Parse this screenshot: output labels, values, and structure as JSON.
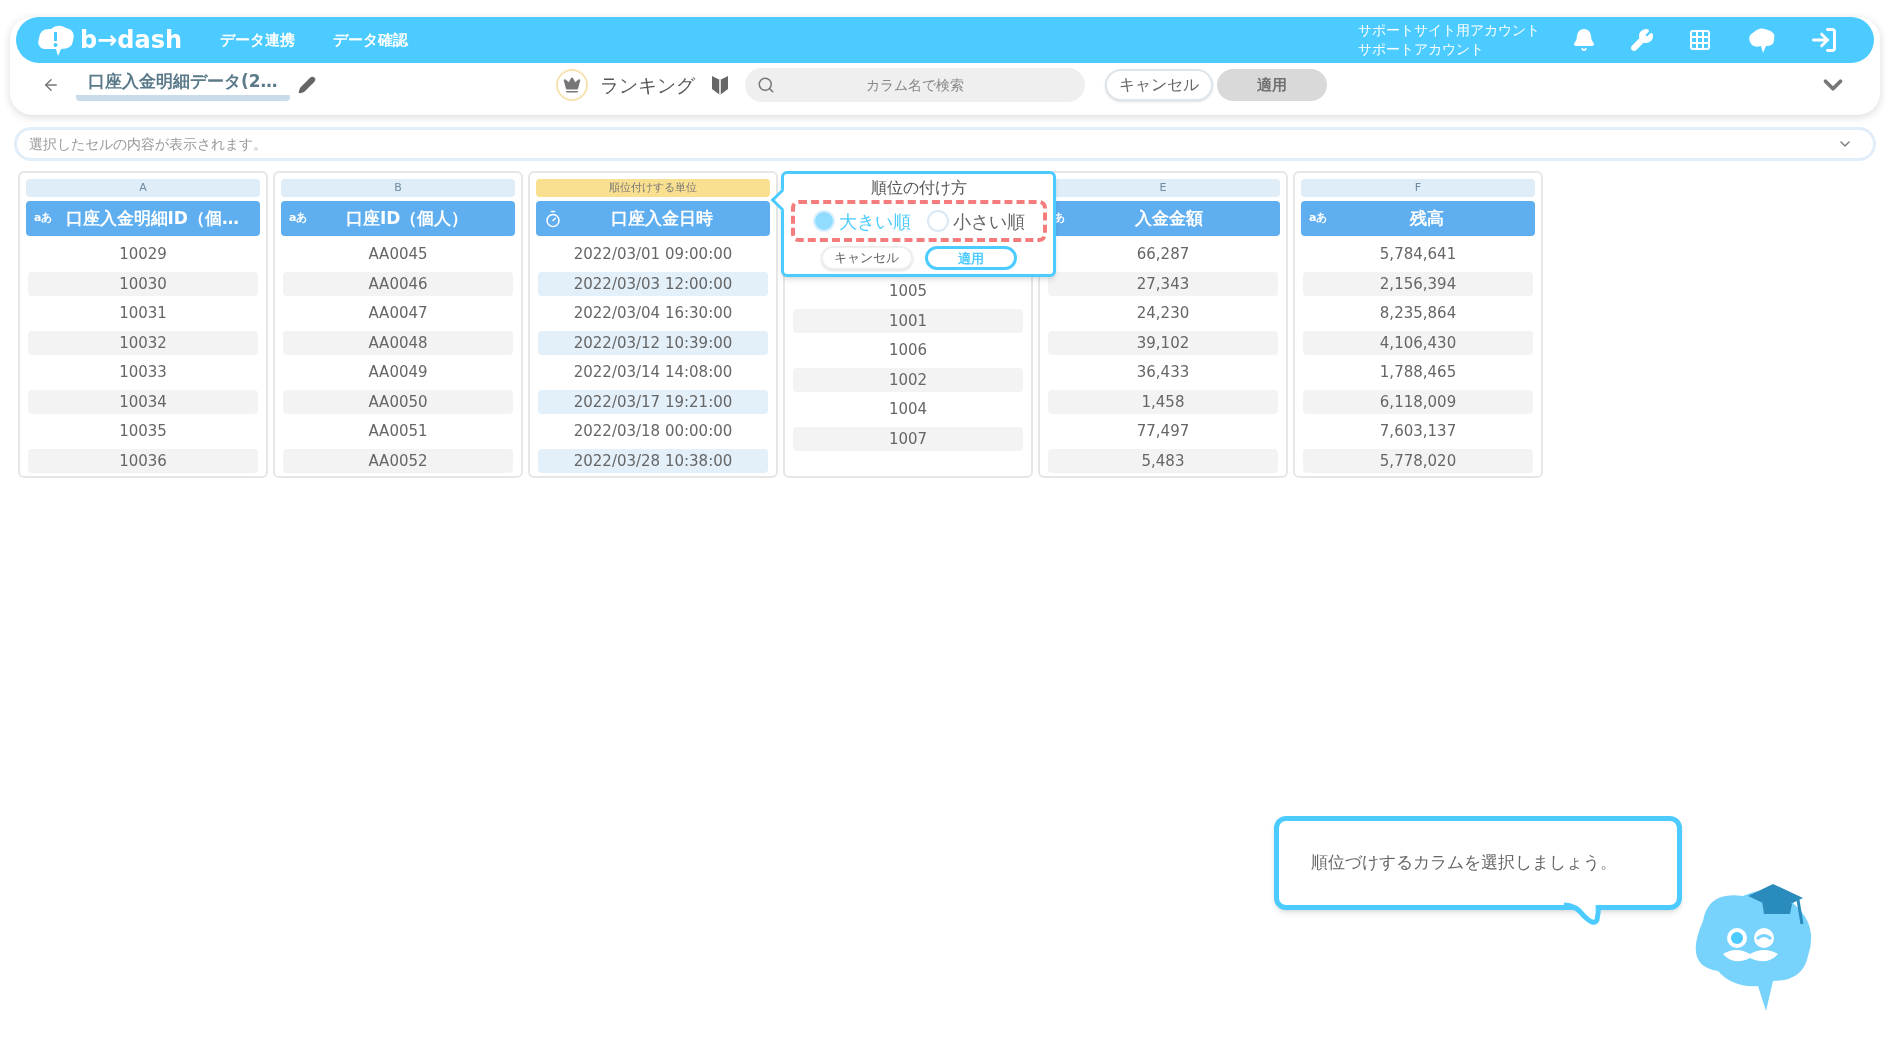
{
  "top_bar": {
    "logo": "b→dash",
    "nav": [
      "データ連携",
      "データ確認"
    ],
    "account": [
      "サポートサイト用アカウント",
      "サポートアカウント"
    ]
  },
  "toolbar": {
    "title": "口座入金明細データ(2…",
    "mode": "ランキング",
    "search": {
      "placeholder": "カラム名で検索"
    },
    "cancel": "キャンセル",
    "apply": {
      "label": "適用",
      "disabled": true
    }
  },
  "cell_bar": {
    "placeholder": "選択したセルの内容が表示されます。"
  },
  "columns": [
    {
      "letter": "A",
      "header": "口座入金明細ID（個…",
      "kind": "text",
      "type_label": "aあ",
      "selected": false,
      "rows": [
        "10029",
        "10030",
        "10031",
        "10032",
        "10033",
        "10034",
        "10035",
        "10036"
      ]
    },
    {
      "letter": "B",
      "header": "口座ID（個人）",
      "kind": "text",
      "type_label": "aあ",
      "selected": false,
      "rows": [
        "AA0045",
        "AA0046",
        "AA0047",
        "AA0048",
        "AA0049",
        "AA0050",
        "AA0051",
        "AA0052"
      ]
    },
    {
      "badge": "順位付けする単位",
      "header": "口座入金日時",
      "kind": "datetime",
      "selected": true,
      "rows": [
        "2022/03/01 09:00:00",
        "2022/03/03 12:00:00",
        "2022/03/04 16:30:00",
        "2022/03/12 10:39:00",
        "2022/03/14 14:08:00",
        "2022/03/17 19:21:00",
        "2022/03/18 00:00:00",
        "2022/03/28 10:38:00"
      ]
    },
    {
      "kind": "covered",
      "selected": false,
      "rows": [
        "1005",
        "1001",
        "1006",
        "1002",
        "1004",
        "1007"
      ]
    },
    {
      "letter": "E",
      "header": "入金金額",
      "kind": "text",
      "type_label": "あ",
      "selected": false,
      "rows": [
        "66,287",
        "27,343",
        "24,230",
        "39,102",
        "36,433",
        "1,458",
        "77,497",
        "5,483"
      ]
    },
    {
      "letter": "F",
      "header": "残高",
      "kind": "text",
      "type_label": "aあ",
      "selected": false,
      "rows": [
        "5,784,641",
        "2,156,394",
        "8,235,864",
        "4,106,430",
        "1,788,465",
        "6,118,009",
        "7,603,137",
        "5,778,020"
      ]
    }
  ],
  "popup": {
    "title": "順位の付け方",
    "options": [
      {
        "label": "大きい順",
        "selected": true
      },
      {
        "label": "小さい順",
        "selected": false
      }
    ],
    "cancel": "キャンセル",
    "apply": "適用"
  },
  "guide": {
    "message": "順位づけするカラムを選択しましょう。"
  }
}
